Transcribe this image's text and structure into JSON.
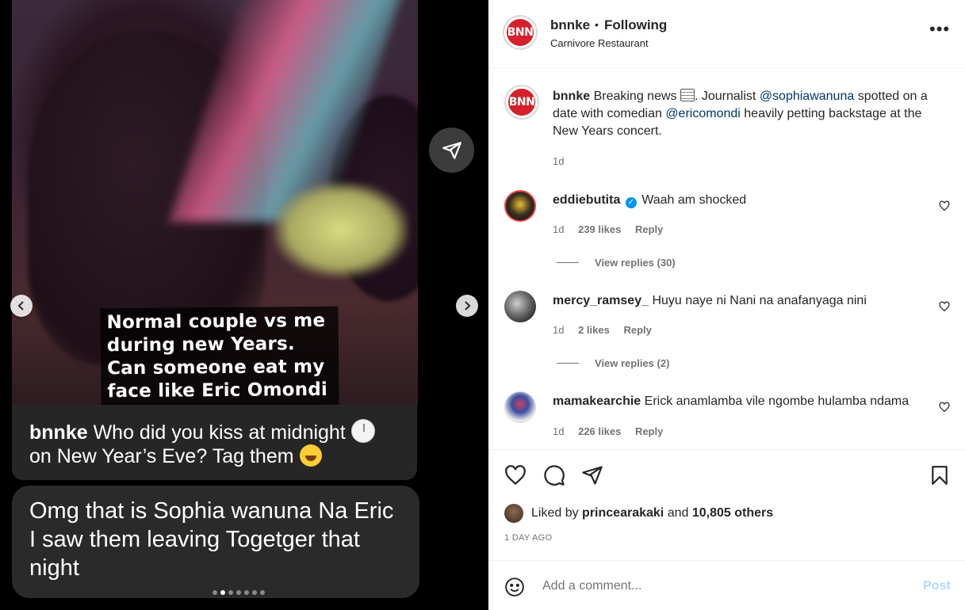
{
  "post": {
    "username": "bnnke",
    "follow_status": "Following",
    "separator": "•",
    "location": "Carnivore Restaurant",
    "avatar_text": "BNN"
  },
  "media": {
    "overlay_caption": "Normal couple vs me during new Years. Can someone eat my face like Eric Omondi",
    "bubble1_user": "bnnke",
    "bubble1_text": "Who did you kiss at midnight",
    "bubble1_text2": "on New Year’s Eve? Tag them",
    "bubble2_text": "Omg that is Sophia wanuna Na Eric I saw them leaving Togetger that night",
    "carousel_dots": 7,
    "active_dot": 2
  },
  "caption": {
    "username": "bnnke",
    "text_part1": "Breaking news",
    "text_part2": ". Journalist",
    "mention1": "@sophiawanuna",
    "text_part3": "spotted on a date with comedian",
    "mention2": "@ericomondi",
    "text_part4": "heavily petting backstage at the New Years concert.",
    "time": "1d"
  },
  "comments": [
    {
      "username": "eddiebutita",
      "verified": true,
      "text": "Waah am shocked",
      "time": "1d",
      "likes": "239 likes",
      "reply": "Reply",
      "view_replies": "View replies (30)"
    },
    {
      "username": "mercy_ramsey_",
      "verified": false,
      "text": "Huyu naye ni Nani na anafanyaga nini",
      "time": "1d",
      "likes": "2 likes",
      "reply": "Reply",
      "view_replies": "View replies (2)"
    },
    {
      "username": "mamakearchie",
      "verified": false,
      "text": "Erick anamlamba vile ngombe hulamba ndama",
      "time": "1d",
      "likes": "226 likes",
      "reply": "Reply"
    }
  ],
  "liked_by": {
    "prefix": "Liked by",
    "user": "princearakaki",
    "and": "and",
    "others": "10,805 others"
  },
  "post_date": "1 DAY AGO",
  "add_comment": {
    "placeholder": "Add a comment...",
    "post_label": "Post"
  },
  "icons": [
    "more-icon",
    "heart-icon",
    "comment-icon",
    "share-icon",
    "bookmark-icon",
    "smile-icon",
    "chevron-left-icon",
    "chevron-right-icon"
  ]
}
